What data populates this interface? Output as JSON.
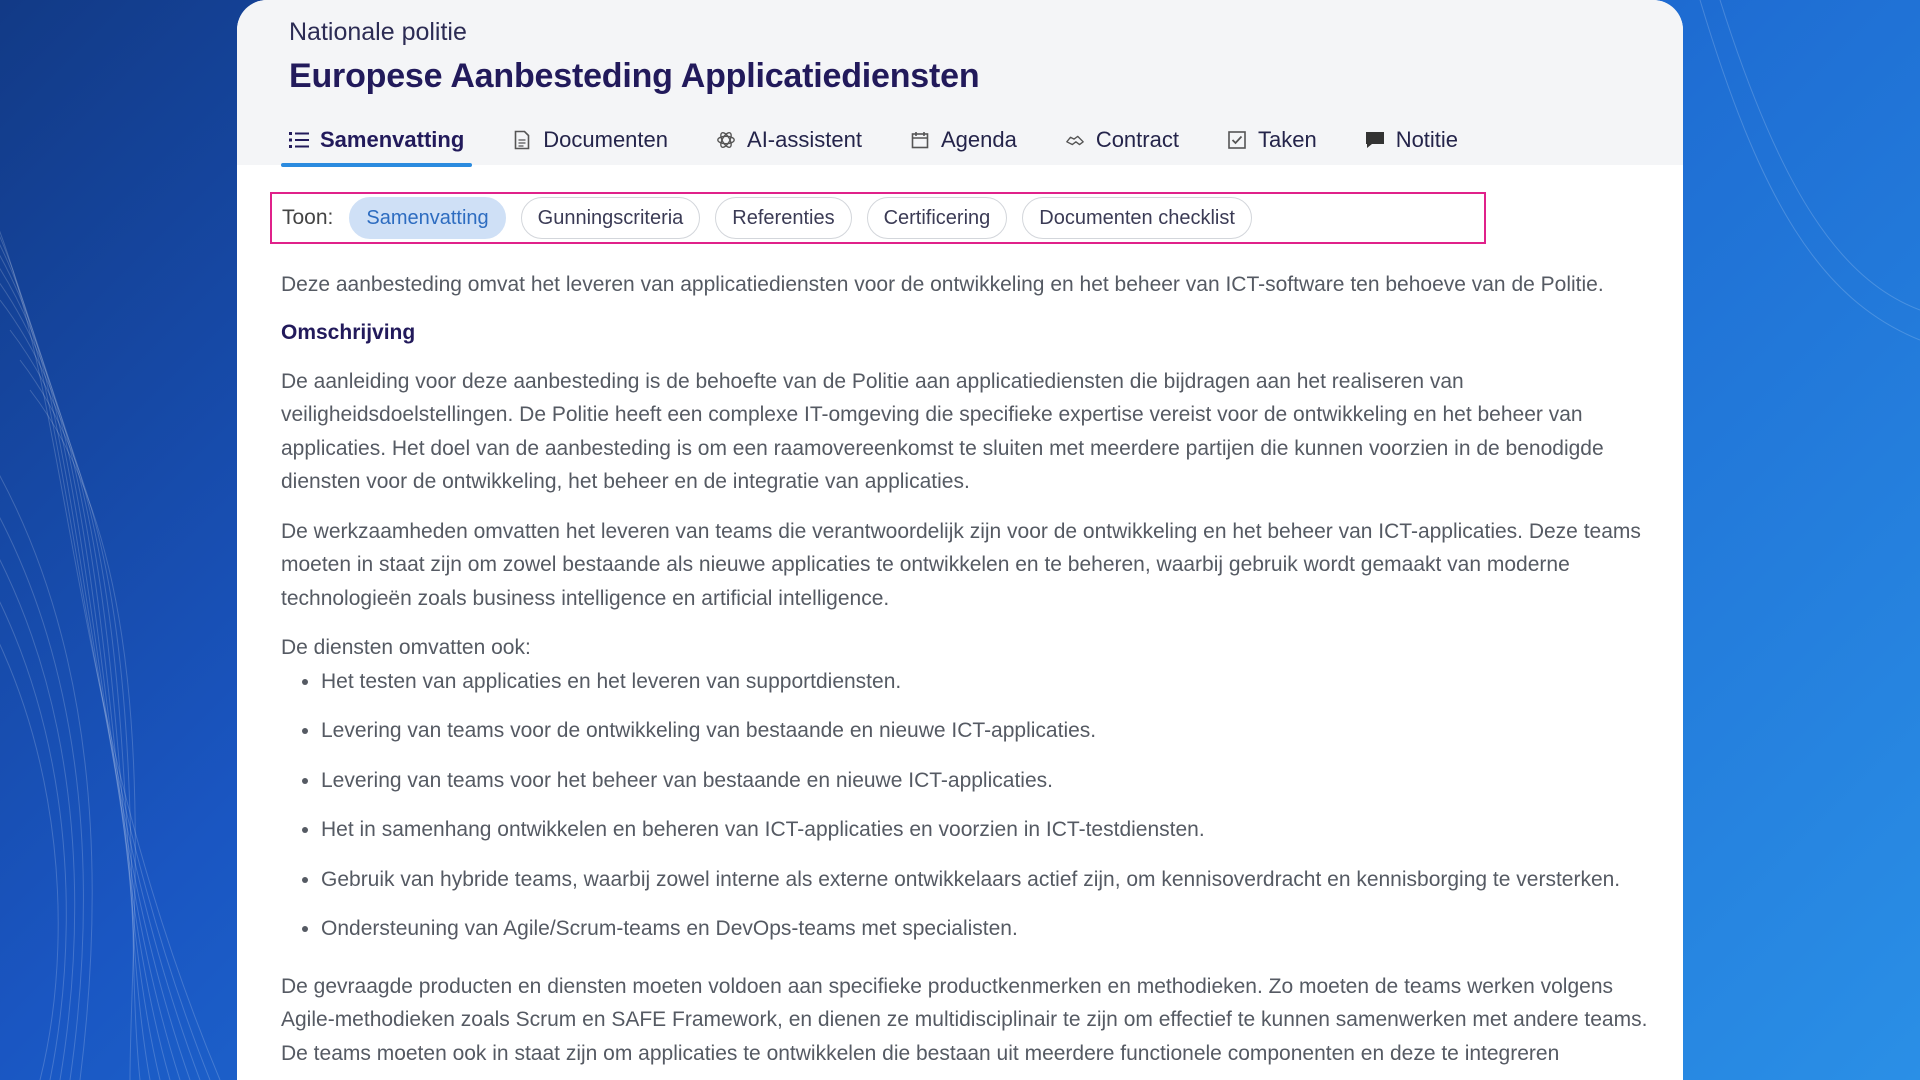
{
  "header": {
    "organization": "Nationale politie",
    "title": "Europese Aanbesteding Applicatiediensten"
  },
  "tabs": [
    {
      "label": "Samenvatting",
      "icon": "list-icon",
      "active": true
    },
    {
      "label": "Documenten",
      "icon": "document-icon",
      "active": false
    },
    {
      "label": "AI-assistent",
      "icon": "ai-icon",
      "active": false
    },
    {
      "label": "Agenda",
      "icon": "calendar-icon",
      "active": false
    },
    {
      "label": "Contract",
      "icon": "handshake-icon",
      "active": false
    },
    {
      "label": "Taken",
      "icon": "checkbox-icon",
      "active": false
    },
    {
      "label": "Notitie",
      "icon": "comment-icon",
      "active": false
    }
  ],
  "filter": {
    "label": "Toon:",
    "chips": [
      "Samenvatting",
      "Gunningscriteria",
      "Referenties",
      "Certificering",
      "Documenten checklist"
    ],
    "active_chip": "Samenvatting"
  },
  "content": {
    "intro": "Deze aanbesteding omvat het leveren van applicatiediensten voor de ontwikkeling en het beheer van ICT-software ten behoeve van de Politie.",
    "heading": "Omschrijving",
    "paragraph1": "De aanleiding voor deze aanbesteding is de behoefte van de Politie aan applicatiediensten die bijdragen aan het realiseren van veiligheidsdoelstellingen. De Politie heeft een complexe IT-omgeving die specifieke expertise vereist voor de ontwikkeling en het beheer van applicaties. Het doel van de aanbesteding is om een raamovereenkomst te sluiten met meerdere partijen die kunnen voorzien in de benodigde diensten voor de ontwikkeling, het beheer en de integratie van applicaties.",
    "paragraph2": "De werkzaamheden omvatten het leveren van teams die verantwoordelijk zijn voor de ontwikkeling en het beheer van ICT-applicaties. Deze teams moeten in staat zijn om zowel bestaande als nieuwe applicaties te ontwikkelen en te beheren, waarbij gebruik wordt gemaakt van moderne technologieën zoals business intelligence en artificial intelligence.",
    "list_intro": "De diensten omvatten ook:",
    "list": [
      "Het testen van applicaties en het leveren van supportdiensten.",
      "Levering van teams voor de ontwikkeling van bestaande en nieuwe ICT-applicaties.",
      "Levering van teams voor het beheer van bestaande en nieuwe ICT-applicaties.",
      "Het in samenhang ontwikkelen en beheren van ICT-applicaties en voorzien in ICT-testdiensten.",
      "Gebruik van hybride teams, waarbij zowel interne als externe ontwikkelaars actief zijn, om kennisoverdracht en kennisborging te versterken.",
      "Ondersteuning van Agile/Scrum-teams en DevOps-teams met specialisten."
    ],
    "paragraph3": "De gevraagde producten en diensten moeten voldoen aan specifieke productkenmerken en methodieken. Zo moeten de teams werken volgens Agile-methodieken zoals Scrum en SAFE Framework, en dienen ze multidisciplinair te zijn om effectief te kunnen samenwerken met andere teams. De teams moeten ook in staat zijn om applicaties te ontwikkelen die bestaan uit meerdere functionele componenten en deze te integreren"
  }
}
